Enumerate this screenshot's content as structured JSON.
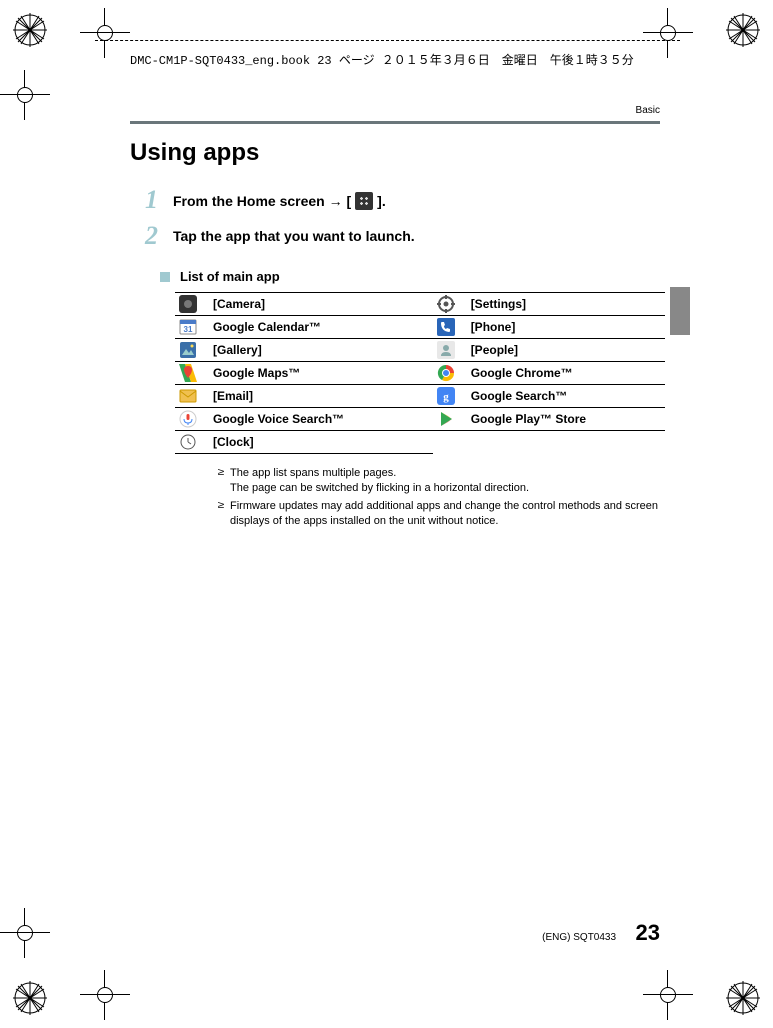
{
  "header_strip": "DMC-CM1P-SQT0433_eng.book  23 ページ  ２０１５年３月６日　金曜日　午後１時３５分",
  "section_label": "Basic",
  "title": "Using apps",
  "steps": [
    {
      "num": "1",
      "pre": "From the Home screen → [",
      "post": "]."
    },
    {
      "num": "2",
      "text": "Tap the app that you want to launch."
    }
  ],
  "subheader": "List of main app",
  "apps_left": [
    "[Camera]",
    "Google Calendar™",
    "[Gallery]",
    "Google Maps™",
    "[Email]",
    "Google Voice Search™",
    "[Clock]"
  ],
  "apps_right": [
    "[Settings]",
    "[Phone]",
    "[People]",
    "Google Chrome™",
    "Google Search™",
    "Google Play™ Store",
    ""
  ],
  "notes": [
    "The app list spans multiple pages.\nThe page can be switched by flicking in a horizontal direction.",
    "Firmware updates may add additional apps and change the control methods and screen displays of the apps installed on the unit without notice."
  ],
  "footer_code": "(ENG) SQT0433",
  "page_number": "23"
}
